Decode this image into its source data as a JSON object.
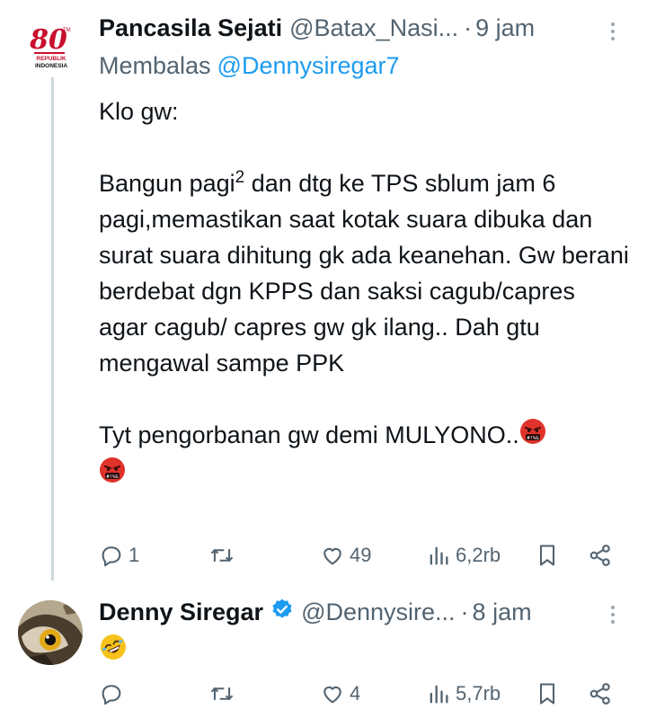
{
  "tweets": [
    {
      "name": "Pancasila Sejati",
      "handle": "@Batax_Nasi...",
      "dot": "·",
      "time": "9 jam",
      "avatar_text": {
        "top": "80",
        "line1": "REPUBLIK",
        "line2": "INDONESIA"
      },
      "reply_prefix": "Membalas",
      "reply_mention": "@Dennysiregar7",
      "text": {
        "p1": "Klo gw:",
        "p2_before": "Bangun pagi",
        "p2_sup": "2",
        "p2_after": " dan dtg ke TPS sblum jam 6 pagi,memastikan saat kotak suara dibuka dan surat suara dihitung gk ada keanehan. Gw berani berdebat dgn KPPS dan saksi cagub/capres agar cagub/ capres gw gk ilang.. Dah gtu mengawal sampe PPK",
        "p3": "Tyt pengorbanan gw demi MULYONO.."
      },
      "emojis": [
        "face-with-symbols-on-mouth",
        "face-with-symbols-on-mouth"
      ],
      "actions": {
        "replies": "1",
        "retweets": "",
        "likes": "49",
        "views": "6,2rb"
      }
    },
    {
      "name": "Denny Siregar",
      "verified": true,
      "handle": "@Dennysire...",
      "dot": "·",
      "time": "8 jam",
      "avatar": "owl-photo",
      "emojis": [
        "rolling-on-the-floor-laughing"
      ],
      "actions": {
        "replies": "",
        "retweets": "",
        "likes": "4",
        "views": "5,7rb"
      }
    }
  ],
  "colors": {
    "text": "#0f1419",
    "secondary": "#536471",
    "link": "#1d9bf0",
    "thread_line": "#cfd9de",
    "logo_red": "#c8102e"
  },
  "icons": [
    "reply-icon",
    "retweet-icon",
    "like-icon",
    "views-icon",
    "bookmark-icon",
    "share-icon",
    "more-icon",
    "verified-badge-icon"
  ]
}
